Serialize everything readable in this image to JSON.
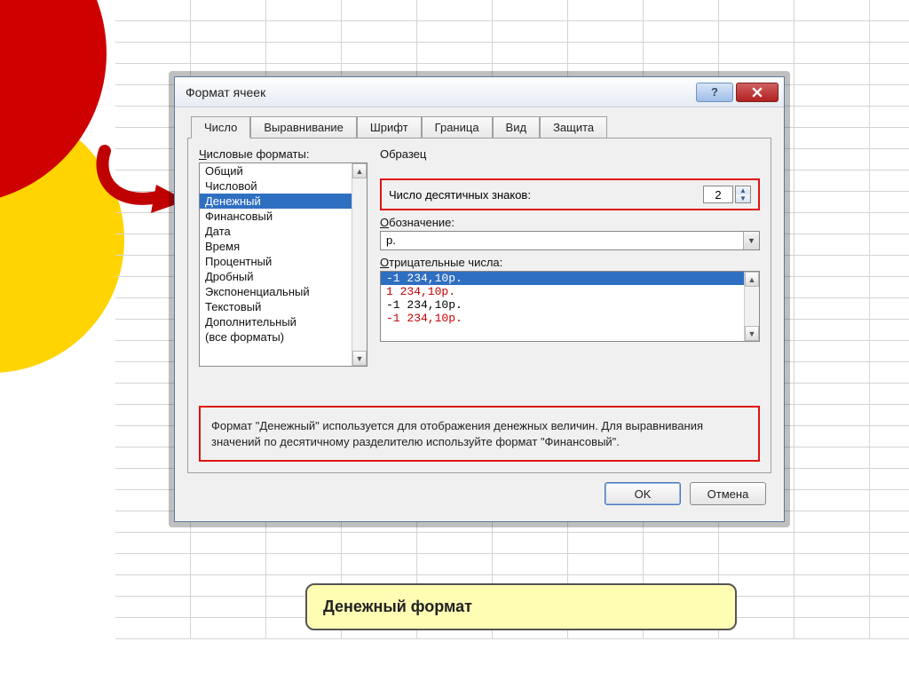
{
  "dialog": {
    "title": "Формат ячеек",
    "help_label": "?",
    "tabs": [
      "Число",
      "Выравнивание",
      "Шрифт",
      "Граница",
      "Вид",
      "Защита"
    ],
    "active_tab": 0,
    "formats_label": "Числовые форматы:",
    "formats": [
      "Общий",
      "Числовой",
      "Денежный",
      "Финансовый",
      "Дата",
      "Время",
      "Процентный",
      "Дробный",
      "Экспоненциальный",
      "Текстовый",
      "Дополнительный",
      "(все форматы)"
    ],
    "selected_format_index": 2,
    "sample_label": "Образец",
    "decimals_label": "Число десятичных знаков:",
    "decimals_value": "2",
    "symbol_label": "Обозначение:",
    "symbol_value": "р.",
    "negatives_label": "Отрицательные числа:",
    "negatives": [
      {
        "text": "-1 234,10р.",
        "color": "sel"
      },
      {
        "text": "1 234,10р.",
        "color": "red"
      },
      {
        "text": "-1 234,10р.",
        "color": "black"
      },
      {
        "text": "-1 234,10р.",
        "color": "red"
      }
    ],
    "description": "Формат \"Денежный\" используется для отображения денежных величин. Для выравнивания значений по десятичному разделителю используйте формат \"Финансовый\".",
    "ok_label": "OK",
    "cancel_label": "Отмена"
  },
  "caption": "Денежный формат"
}
